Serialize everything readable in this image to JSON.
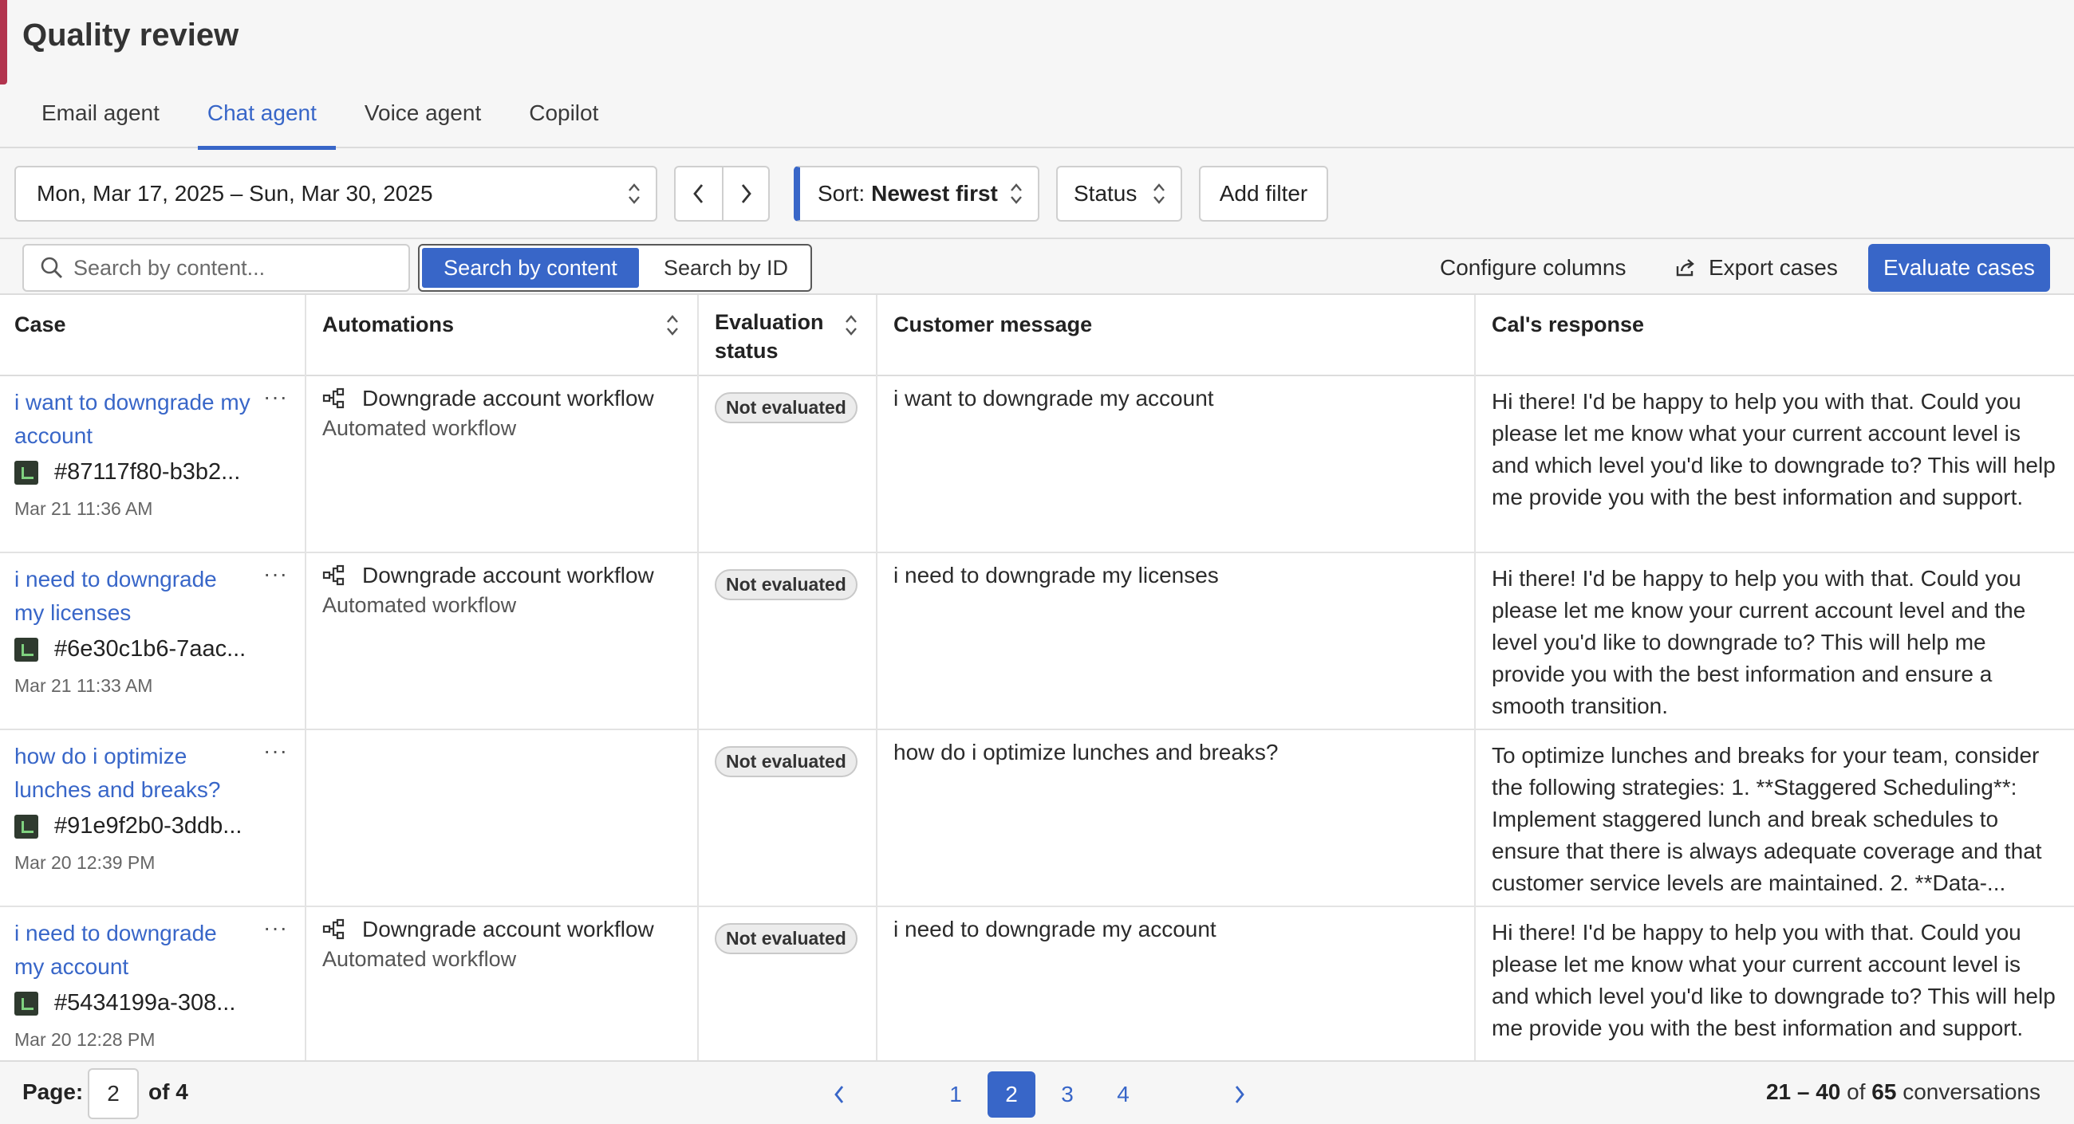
{
  "header": {
    "title": "Quality review"
  },
  "tabs": [
    {
      "label": "Email agent"
    },
    {
      "label": "Chat agent"
    },
    {
      "label": "Voice agent"
    },
    {
      "label": "Copilot"
    }
  ],
  "active_tab": "Chat agent",
  "controls": {
    "date_range": "Mon, Mar 17, 2025 – Sun, Mar 30, 2025",
    "sort_prefix": "Sort:",
    "sort_value": "Newest first",
    "status_label": "Status",
    "add_filter_label": "Add filter"
  },
  "search": {
    "placeholder": "Search by content...",
    "mode_content": "Search by content",
    "mode_id": "Search by ID",
    "active_mode": "Search by content"
  },
  "actions": {
    "configure_columns": "Configure columns",
    "export_cases": "Export cases",
    "evaluate_cases": "Evaluate cases"
  },
  "table": {
    "columns": {
      "case": "Case",
      "automations": "Automations",
      "evaluation_status_line1": "Evaluation",
      "evaluation_status_line2": "status",
      "customer_message": "Customer message",
      "response": "Cal's response"
    },
    "rows": [
      {
        "title": "i want to downgrade my account",
        "id": "#87117f80-b3b2...",
        "date": "Mar 21 11:36 AM",
        "automation": "Downgrade account workflow",
        "automation_type": "Automated workflow",
        "status": "Not evaluated",
        "message": "i want to downgrade my account",
        "response": "Hi there! I'd be happy to help you with that. Could you please let me know what your current account level is and which level you'd like to downgrade to? This will help me provide you with the best information and support."
      },
      {
        "title": "i need to downgrade my licenses",
        "id": "#6e30c1b6-7aac...",
        "date": "Mar 21 11:33 AM",
        "automation": "Downgrade account workflow",
        "automation_type": "Automated workflow",
        "status": "Not evaluated",
        "message": "i need to downgrade my licenses",
        "response": "Hi there! I'd be happy to help you with that. Could you please let me know your current account level and the level you'd like to downgrade to? This will help me provide you with the best information and ensure a smooth transition."
      },
      {
        "title": "how do i optimize lunches and breaks?",
        "id": "#91e9f2b0-3ddb...",
        "date": "Mar 20 12:39 PM",
        "automation": "",
        "automation_type": "",
        "status": "Not evaluated",
        "message": "how do i optimize lunches and breaks?",
        "response": "To optimize lunches and breaks for your team, consider the following strategies: 1. **Staggered Scheduling**: Implement staggered lunch and break schedules to ensure that there is always adequate coverage and that customer service levels are maintained. 2. **Data-..."
      },
      {
        "title": "i need to downgrade my account",
        "id": "#5434199a-308...",
        "date": "Mar 20 12:28 PM",
        "automation": "Downgrade account workflow",
        "automation_type": "Automated workflow",
        "status": "Not evaluated",
        "message": "i need to downgrade my account",
        "response": "Hi there! I'd be happy to help you with that. Could you please let me know what your current account level is and which level you'd like to downgrade to? This will help me provide you with the best information and support."
      }
    ]
  },
  "pagination": {
    "page_label": "Page:",
    "current_page": "2",
    "of_label": "of 4",
    "pages": [
      "1",
      "2",
      "3",
      "4"
    ],
    "range": "21 – 40",
    "of_word": "of",
    "total": "65",
    "unit": "conversations"
  },
  "colors": {
    "accent": "#3866c8",
    "brand_strip": "#b2344e"
  },
  "icons": [
    "chevron-left-icon",
    "chevron-right-icon",
    "search-icon",
    "export-icon",
    "workflow-icon",
    "sort-updown-icon"
  ]
}
